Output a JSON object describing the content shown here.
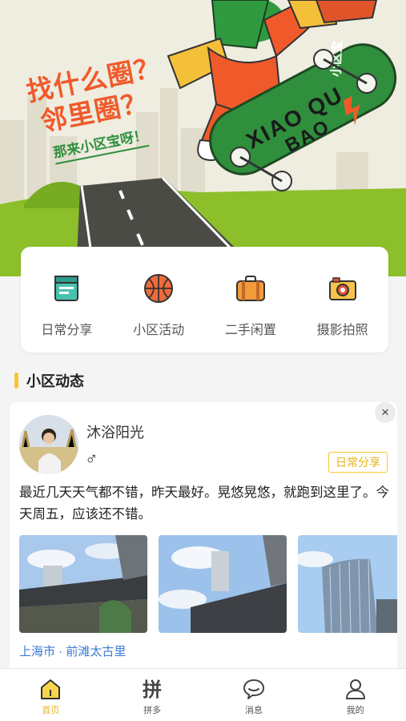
{
  "hero": {
    "slogan_line1": "找什么圈？",
    "slogan_line2": "邻里圈？",
    "slogan_sub": "那来小区宝呀！",
    "brand_board": "小区宝",
    "brand_en": "XIAO QU BAO",
    "colors": {
      "orange": "#f05a2a",
      "green": "#2c8f3c",
      "grass": "#8cbf2a",
      "road": "#4b4b45"
    }
  },
  "categories": [
    {
      "label": "日常分享",
      "icon": "book-icon"
    },
    {
      "label": "小区活动",
      "icon": "basketball-icon"
    },
    {
      "label": "二手闲置",
      "icon": "suitcase-icon"
    },
    {
      "label": "摄影拍照",
      "icon": "camera-icon"
    }
  ],
  "section": {
    "title": "小区动态"
  },
  "post": {
    "user": "沐浴阳光",
    "gender": "♂",
    "tag": "日常分享",
    "text": "最近几天天气都不错，昨天最好。晃悠晃悠，就跑到这里了。今天周五，应该还不错。",
    "location": "上海市 · 前滩太古里",
    "close": "×"
  },
  "tabs": [
    {
      "label": "首页",
      "icon": "home-icon",
      "active": true
    },
    {
      "label": "拼多",
      "icon": "pin-icon",
      "active": false
    },
    {
      "label": "消息",
      "icon": "message-icon",
      "active": false
    },
    {
      "label": "我的",
      "icon": "profile-icon",
      "active": false
    }
  ],
  "accent": "#f7c531"
}
